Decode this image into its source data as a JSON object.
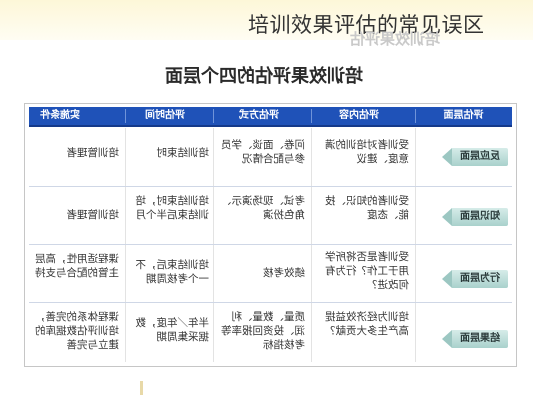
{
  "page": {
    "title": "培训效果评估的常见误区",
    "ghost_title": "培训效果评估",
    "table_title": "培训效果评估的四个层面"
  },
  "table": {
    "headers": {
      "level": "评估层面",
      "content": "评估内容",
      "method": "评估方式",
      "time": "评估时间",
      "conditions": "实施条件"
    },
    "rows": [
      {
        "level": "反应层面",
        "content": "受训者对培训的满意度、建议",
        "method": "问卷、面谈、学员参与配合情况",
        "time": "培训结束时",
        "conditions": "培训管理者"
      },
      {
        "level": "知识层面",
        "content": "受训者的知识、技能、态度",
        "method": "考试、现场演示、角色扮演",
        "time": "培训结束时，培训结束后半个月",
        "conditions": "培训管理者"
      },
      {
        "level": "行为层面",
        "content": "受训者是否将所学用于工作？行为有何改进？",
        "method": "绩效考核",
        "time": "培训结束后，不一个考核周期",
        "conditions": "课程适用性，高层主管的配合与支持"
      },
      {
        "level": "结果层面",
        "content": "培训为经济效益提高产生多大贡献？",
        "method": "质量、数量、利润、投资回报率等考核指标",
        "time": "半年／年度，数据采集周期",
        "conditions": "课程体系的完善，培训评估数据库的建立与完善"
      }
    ]
  },
  "colors": {
    "header_bg": "#1f52b8",
    "tag_bg": "#a9d1cc",
    "title_band": "#fdf7d8"
  }
}
